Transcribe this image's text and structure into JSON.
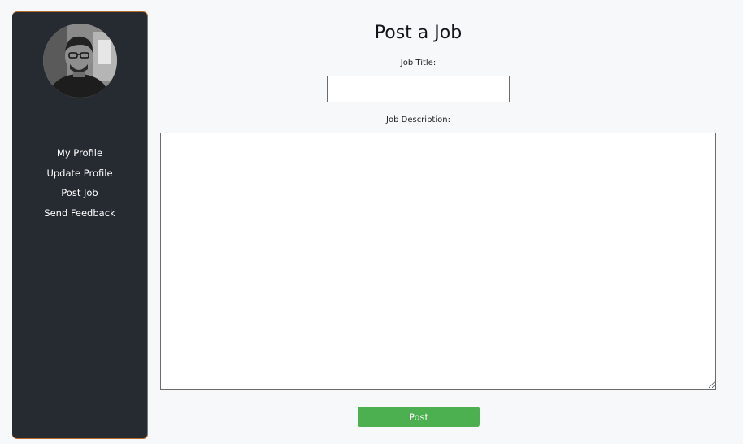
{
  "sidebar": {
    "avatar_alt": "profile photo",
    "items": [
      {
        "label": "My Profile"
      },
      {
        "label": "Update Profile"
      },
      {
        "label": "Post Job"
      },
      {
        "label": "Send Feedback"
      }
    ]
  },
  "main": {
    "title": "Post a Job",
    "job_title_label": "Job Title:",
    "job_title_value": "",
    "job_description_label": "Job Description:",
    "job_description_value": "",
    "post_button_label": "Post"
  },
  "colors": {
    "sidebar_bg": "#262b32",
    "sidebar_border": "#b66a2c",
    "page_bg": "#f7f8fa",
    "post_button": "#4caf50"
  }
}
